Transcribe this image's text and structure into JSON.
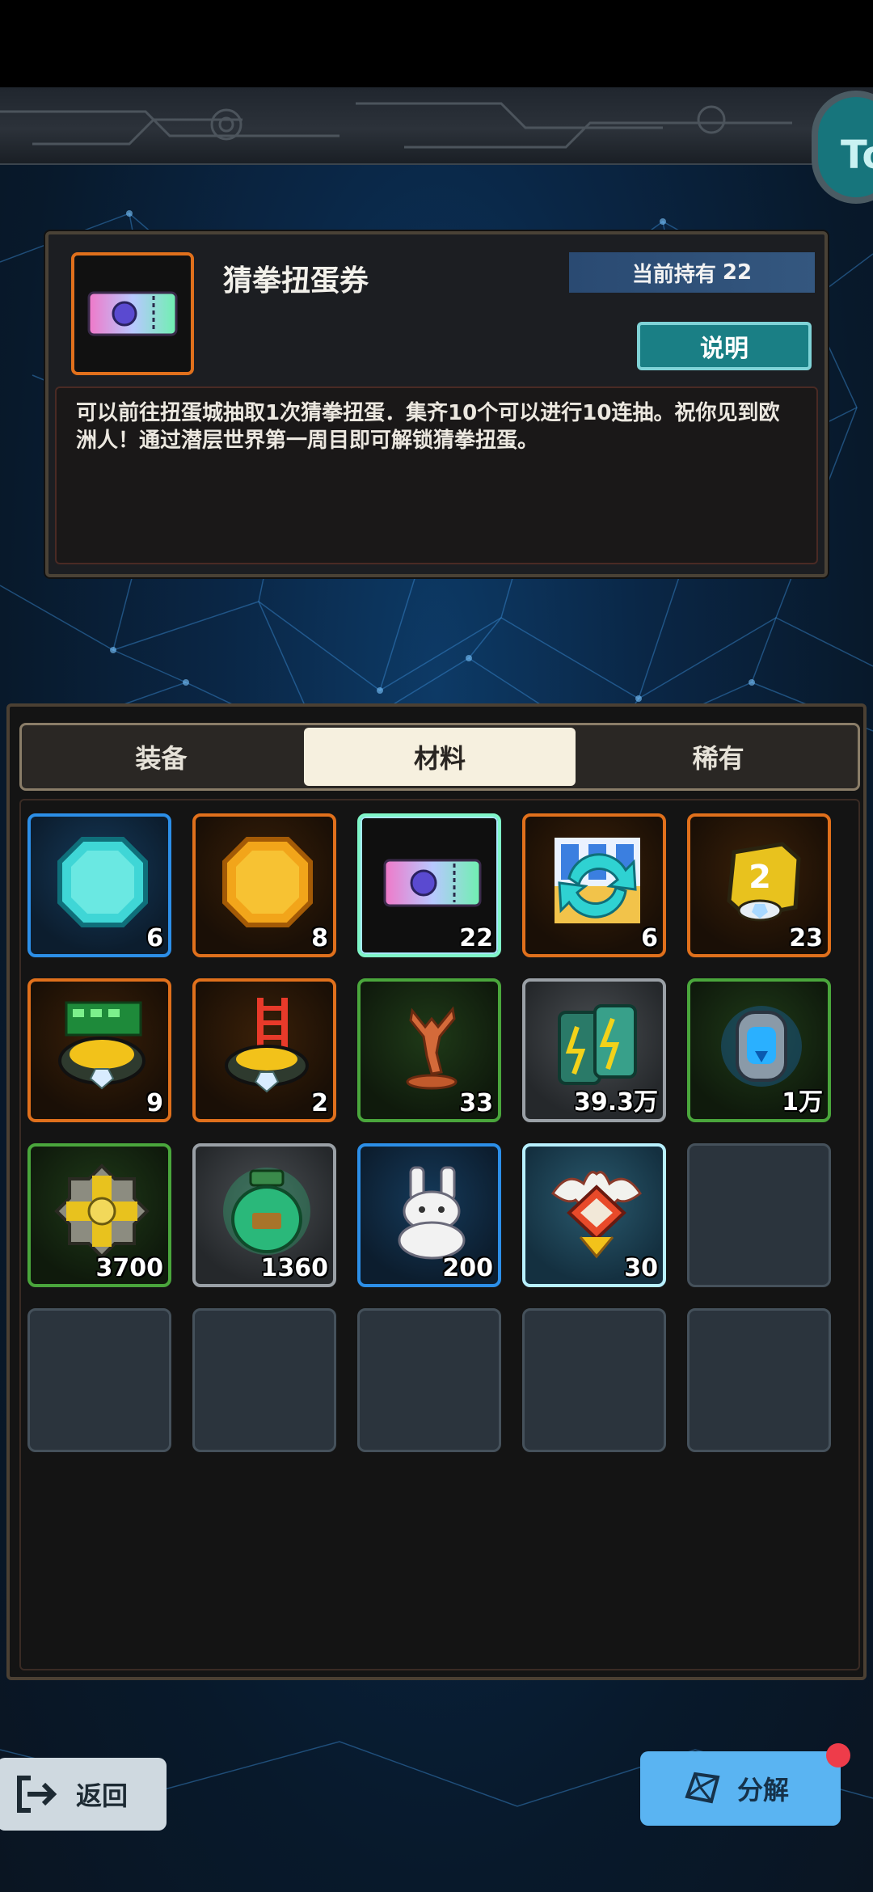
{
  "header": {
    "avatar_text": "To"
  },
  "detail": {
    "icon": "gacha-ticket-icon",
    "title": "猜拳扭蛋券",
    "owned_label": "当前持有",
    "owned_count": "22",
    "explain_label": "说明",
    "description": "可以前往扭蛋城抽取1次猜拳扭蛋．集齐10个可以进行10连抽。祝你见到欧洲人！通过潜层世界第一周目即可解锁猜拳扭蛋。"
  },
  "tabs": [
    {
      "label": "装备",
      "active": false
    },
    {
      "label": "材料",
      "active": true
    },
    {
      "label": "稀有",
      "active": false
    }
  ],
  "items": [
    {
      "icon": "cyan-gem-coin-icon",
      "count": "6",
      "rarity": "blue"
    },
    {
      "icon": "gold-coin-icon",
      "count": "8",
      "rarity": "orange"
    },
    {
      "icon": "gacha-ticket-icon",
      "count": "22",
      "rarity": "selected"
    },
    {
      "icon": "recycle-arrows-icon",
      "count": "6",
      "rarity": "orange"
    },
    {
      "icon": "gold-box-2-icon",
      "count": "23",
      "rarity": "orange"
    },
    {
      "icon": "circuit-board-helmet-icon",
      "count": "9",
      "rarity": "orange"
    },
    {
      "icon": "ladder-helmet-icon",
      "count": "2",
      "rarity": "orange"
    },
    {
      "icon": "bronze-statue-icon",
      "count": "33",
      "rarity": "green"
    },
    {
      "icon": "energy-battery-icon",
      "count": "39.3万",
      "rarity": "gray"
    },
    {
      "icon": "blue-armor-core-icon",
      "count": "1万",
      "rarity": "green"
    },
    {
      "icon": "golden-gear-core-icon",
      "count": "3700",
      "rarity": "green"
    },
    {
      "icon": "green-potion-jar-icon",
      "count": "1360",
      "rarity": "gray"
    },
    {
      "icon": "white-rabbit-icon",
      "count": "200",
      "rarity": "blue"
    },
    {
      "icon": "ornate-emblem-icon",
      "count": "30",
      "rarity": "cyan"
    }
  ],
  "footer": {
    "back_label": "返回",
    "decompose_label": "分解"
  }
}
